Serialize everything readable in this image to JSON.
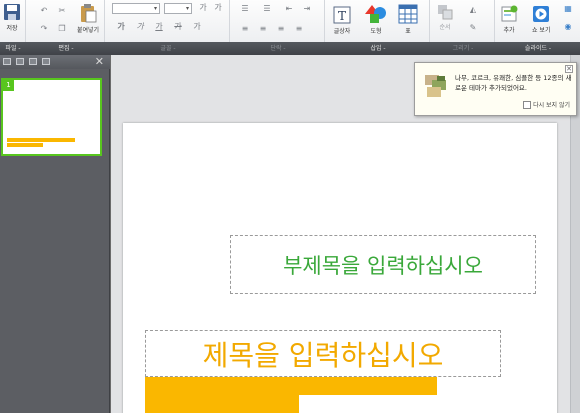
{
  "ribbon": {
    "file": {
      "save": "저장",
      "label": "파일 -"
    },
    "edit": {
      "paste": "붙여넣기",
      "label": "편집 -"
    },
    "font": {
      "label": "글꼴 -",
      "styles": [
        "가",
        "가",
        "가",
        "가",
        "가"
      ]
    },
    "paragraph": {
      "label": "단락 -"
    },
    "insert": {
      "textbox": "글상자",
      "shape": "도형",
      "table": "표",
      "label": "삽입 -"
    },
    "drawing": {
      "arrange": "순서",
      "label": "그리기 -"
    },
    "slide": {
      "add": "추가",
      "show": "쇼 보기",
      "label": "슬라이드 -"
    }
  },
  "thumbs": [
    {
      "number": "1"
    }
  ],
  "slide": {
    "subtitle_placeholder": "부제목을 입력하십시오",
    "title_placeholder": "제목을 입력하십시오"
  },
  "notification": {
    "message": "나무, 코르크, 유쾌한, 심플한 등 12종의 새로운 테마가 추가되었어요.",
    "dont_show": "다시 보지 않기",
    "close": "✕"
  },
  "colors": {
    "accent_green": "#58c61e",
    "title_orange": "#f2a900",
    "bar_orange": "#fab700",
    "subtitle_green": "#3aa83a"
  }
}
